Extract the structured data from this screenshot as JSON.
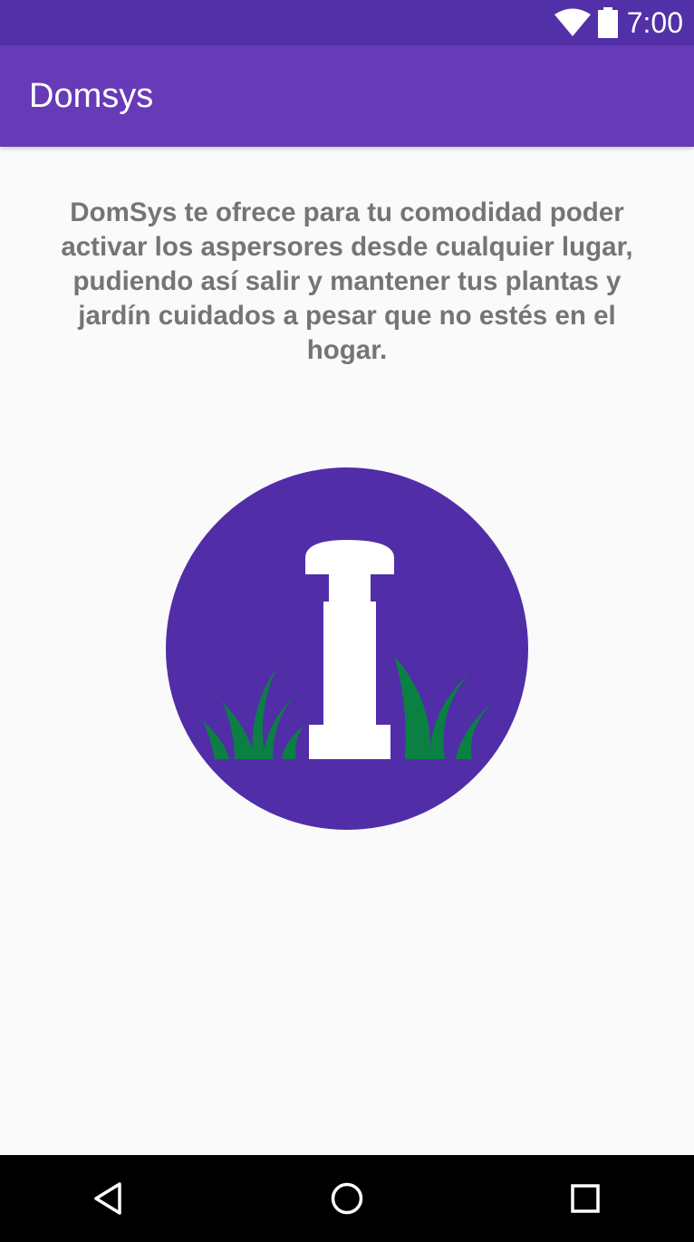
{
  "status_bar": {
    "time": "7:00",
    "icons": [
      "wifi-icon",
      "battery-icon"
    ]
  },
  "app_bar": {
    "title": "Domsys",
    "color": "#673ab7",
    "status_color": "#5230a8"
  },
  "main": {
    "description": "DomSys te ofrece para tu comodidad poder activar los aspersores desde cualquier lugar, pudiendo así salir y mantener tus plantas y jardín cuidados a pesar que no estés en el hogar.",
    "illustration": {
      "icon": "sprinkler-icon",
      "circle_color": "#512da8",
      "grass_color": "#0b8043",
      "sprinkler_color": "#ffffff"
    }
  },
  "nav_bar": {
    "buttons": [
      "back-icon",
      "home-icon",
      "recents-icon"
    ]
  }
}
